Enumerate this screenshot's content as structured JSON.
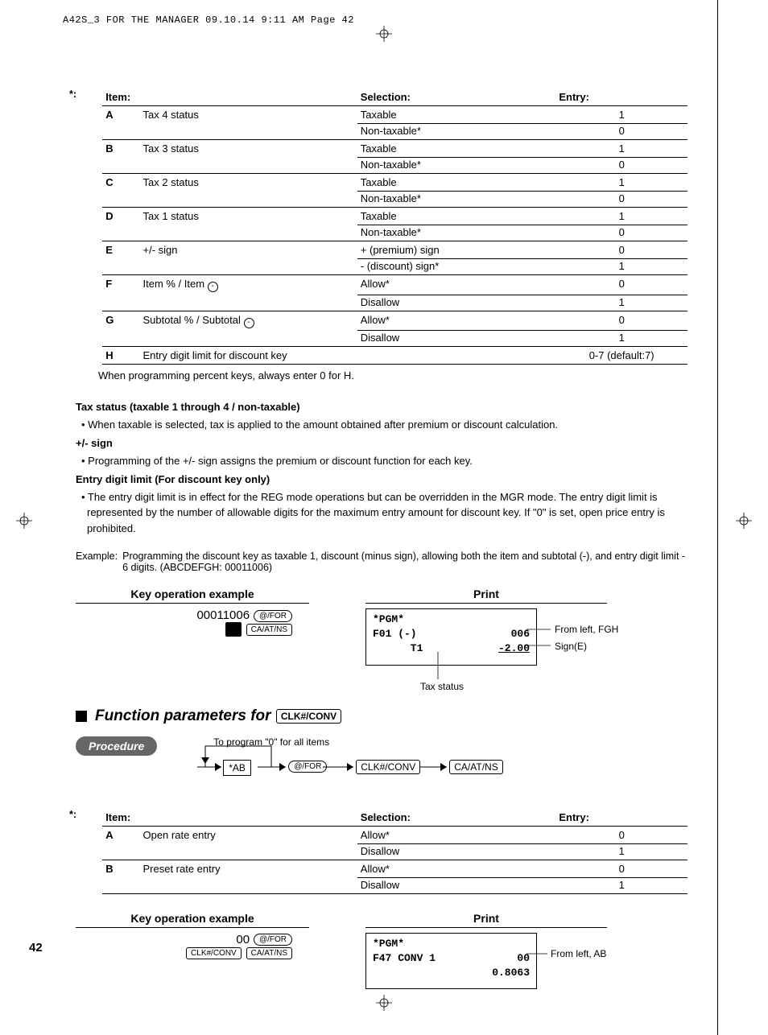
{
  "print_header": "A42S_3 FOR THE MANAGER  09.10.14 9:11 AM  Page 42",
  "page_number": "42",
  "table1": {
    "h_star": "*:",
    "h_item": "Item:",
    "h_sel": "Selection:",
    "h_entry": "Entry:",
    "rows": [
      {
        "id": "A",
        "desc": "Tax 4 status",
        "sel1": "Taxable",
        "e1": "1",
        "sel2": "Non-taxable*",
        "e2": "0"
      },
      {
        "id": "B",
        "desc": "Tax 3 status",
        "sel1": "Taxable",
        "e1": "1",
        "sel2": "Non-taxable*",
        "e2": "0"
      },
      {
        "id": "C",
        "desc": "Tax 2 status",
        "sel1": "Taxable",
        "e1": "1",
        "sel2": "Non-taxable*",
        "e2": "0"
      },
      {
        "id": "D",
        "desc": "Tax 1 status",
        "sel1": "Taxable",
        "e1": "1",
        "sel2": "Non-taxable*",
        "e2": "0"
      },
      {
        "id": "E",
        "desc": "+/- sign",
        "sel1": "+ (premium) sign",
        "e1": "0",
        "sel2": "- (discount) sign*",
        "e2": "1"
      },
      {
        "id": "F",
        "desc": "Item % / Item ⊖",
        "sel1": "Allow*",
        "e1": "0",
        "sel2": "Disallow",
        "e2": "1"
      },
      {
        "id": "G",
        "desc": "Subtotal % / Subtotal ⊖",
        "sel1": "Allow*",
        "e1": "0",
        "sel2": "Disallow",
        "e2": "1"
      },
      {
        "id": "H",
        "desc": "Entry digit limit for discount key",
        "sel1": "",
        "e1": "0-7 (default:7)",
        "sel2": null,
        "e2": null
      }
    ],
    "note": "When programming percent keys, always enter 0 for H."
  },
  "body": {
    "h1": "Tax status (taxable 1 through 4 / non-taxable)",
    "b1": "• When taxable is selected, tax is applied to the amount obtained after premium or discount calculation.",
    "h2": "+/- sign",
    "b2": "• Programming of the +/- sign assigns the premium or discount function for each key.",
    "h3": "Entry digit limit (For discount key only)",
    "b3": "• The entry digit limit is in effect for the REG mode operations but can be overridden in the MGR mode.  The entry digit limit is represented by the number of allowable digits for the maximum entry amount for discount key.  If \"0\" is set, open price entry is prohibited."
  },
  "example1": {
    "label": "Example:",
    "text": "Programming the discount key as taxable 1, discount (minus sign), allowing both the item and subtotal (-), and entry digit limit - 6 digits.  (ABCDEFGH: 00011006)",
    "key_title": "Key operation example",
    "print_title": "Print",
    "seq_num": "00011006",
    "key_for": "@/FOR",
    "key_minus": "⊖",
    "key_caat": "CA/AT/NS",
    "receipt": {
      "l1": "*PGM*",
      "l2a": "F01 (-)",
      "l2b": "006",
      "l3a": "      T1",
      "l3b": "-2.00"
    },
    "anno1": "From left, FGH",
    "anno2": "Sign(E)",
    "anno3": "Tax status"
  },
  "section2": {
    "title_pre": "Function parameters for",
    "title_key": "CLK#/CONV",
    "procedure": "Procedure",
    "note": "To program \"0\" for all items",
    "flow_ab": "*AB",
    "flow_for": "@/FOR",
    "flow_conv": "CLK#/CONV",
    "flow_caat": "CA/AT/NS"
  },
  "table2": {
    "h_star": "*:",
    "h_item": "Item:",
    "h_sel": "Selection:",
    "h_entry": "Entry:",
    "rows": [
      {
        "id": "A",
        "desc": "Open rate entry",
        "sel1": "Allow*",
        "e1": "0",
        "sel2": "Disallow",
        "e2": "1"
      },
      {
        "id": "B",
        "desc": "Preset rate entry",
        "sel1": "Allow*",
        "e1": "0",
        "sel2": "Disallow",
        "e2": "1"
      }
    ]
  },
  "example2": {
    "key_title": "Key operation example",
    "print_title": "Print",
    "seq_num": "00",
    "key_for": "@/FOR",
    "key_conv": "CLK#/CONV",
    "key_caat": "CA/AT/NS",
    "receipt": {
      "l1": "*PGM*",
      "l2a": "F47 CONV 1",
      "l2b": "00",
      "l3b": "0.8063"
    },
    "anno1": "From left, AB"
  }
}
